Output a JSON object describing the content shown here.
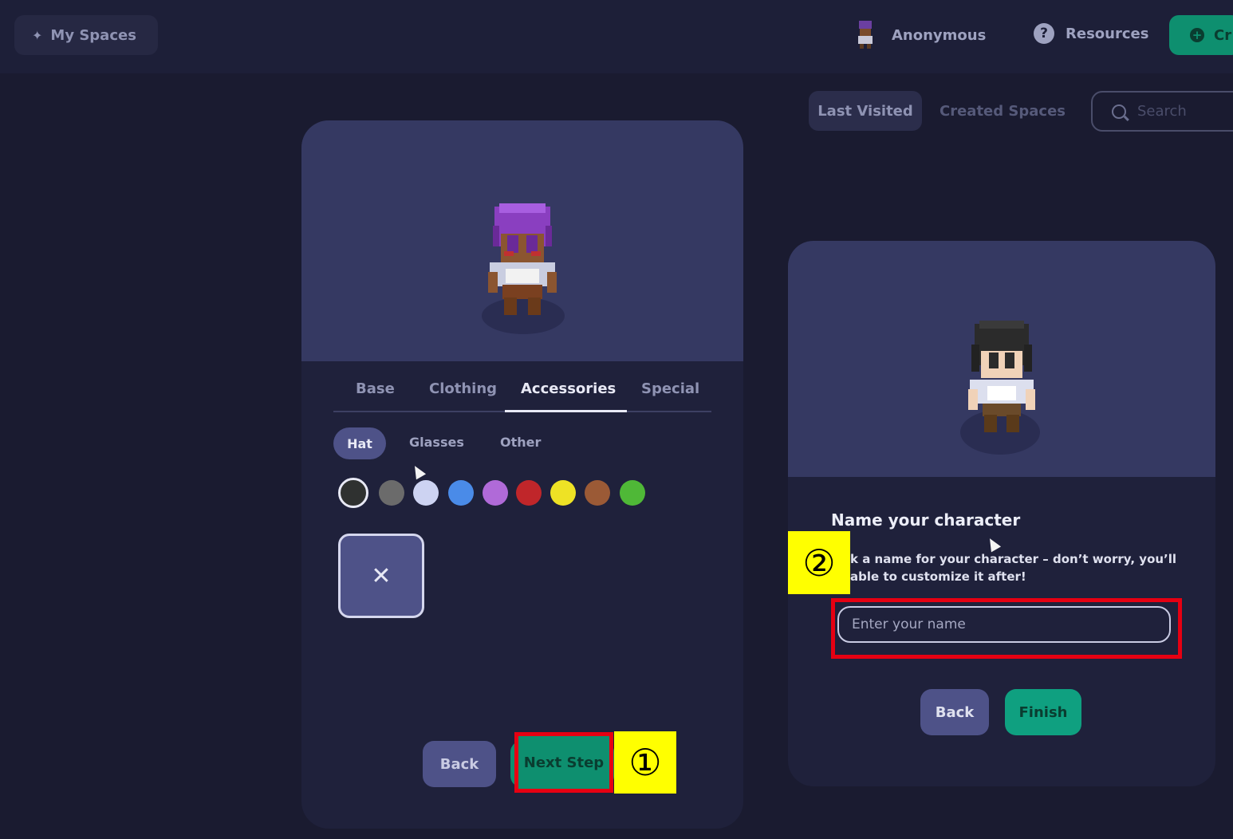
{
  "header": {
    "my_spaces_label": "My Spaces",
    "user_name": "Anonymous",
    "resources_label": "Resources",
    "create_label": "Cr"
  },
  "spaces_nav": {
    "last_visited": "Last Visited",
    "created_spaces": "Created Spaces",
    "search_placeholder": "Search"
  },
  "customizer": {
    "categories": [
      "Base",
      "Clothing",
      "Accessories",
      "Special"
    ],
    "active_category": "Accessories",
    "subtabs": [
      "Hat",
      "Glasses",
      "Other"
    ],
    "active_subtab": "Hat",
    "swatches": [
      "#2f3130",
      "#6b6b6b",
      "#cdd3f2",
      "#4a8be8",
      "#b06ad8",
      "#c0262a",
      "#eee225",
      "#9b5a36",
      "#4fb837"
    ],
    "none_symbol": "✕",
    "back_label": "Back",
    "next_label": "Next Step"
  },
  "name_dialog": {
    "title": "Name your character",
    "description": "k a name for your character – don’t worry, you’ll able to customize it after!",
    "input_placeholder": "Enter your name",
    "back_label": "Back",
    "finish_label": "Finish"
  },
  "annotations": {
    "marker_1": "①",
    "marker_2": "②"
  },
  "colors": {
    "accent_green": "#0e8f6f",
    "highlight_red": "#e60012",
    "marker_yellow": "#ffff00"
  }
}
